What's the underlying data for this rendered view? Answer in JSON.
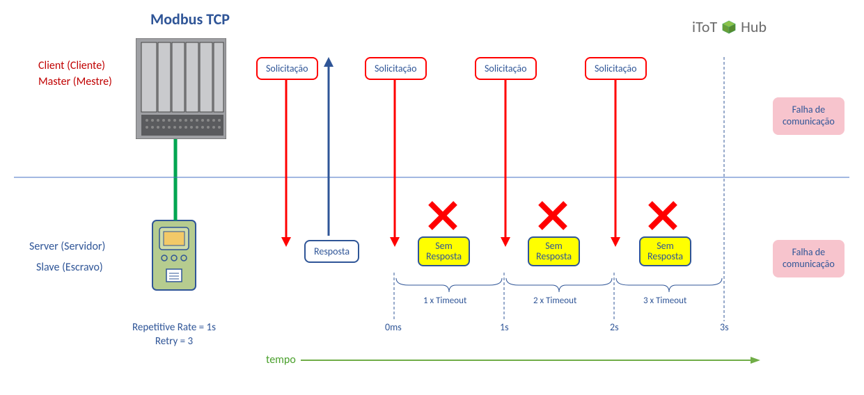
{
  "title": "Modbus TCP",
  "logo_prefix": "iToT",
  "logo_suffix": "Hub",
  "roles": {
    "client": "Client (Cliente)",
    "master": "Master (Mestre)",
    "server": "Server (Servidor)",
    "slave": "Slave (Escravo)"
  },
  "params": {
    "rate": "Repetitive Rate = 1s",
    "retry": "Retry = 3"
  },
  "solicitacao": "Solicitação",
  "resposta": "Resposta",
  "sem_resposta_l1": "Sem",
  "sem_resposta_l2": "Resposta",
  "falha_l1": "Falha de",
  "falha_l2": "comunicação",
  "timeouts": [
    "1 x Timeout",
    "2 x Timeout",
    "3 x Timeout"
  ],
  "ticks": [
    "0ms",
    "1s",
    "2s",
    "3s"
  ],
  "tempo": "tempo",
  "chart_data": {
    "type": "sequence",
    "title": "Modbus TCP communication timeout sequence",
    "actors": [
      "Client/Master (PLC)",
      "Server/Slave (Device)"
    ],
    "parameters": {
      "repetitive_rate_s": 1,
      "retry_count": 3
    },
    "events": [
      {
        "t_s": null,
        "label": "Solicitação",
        "direction": "client_to_server",
        "response": "Resposta"
      },
      {
        "t_s": 0,
        "label": "Solicitação",
        "direction": "client_to_server",
        "response": "Sem Resposta",
        "timeout_index": 1
      },
      {
        "t_s": 1,
        "label": "Solicitação",
        "direction": "client_to_server",
        "response": "Sem Resposta",
        "timeout_index": 2
      },
      {
        "t_s": 2,
        "label": "Solicitação",
        "direction": "client_to_server",
        "response": "Sem Resposta",
        "timeout_index": 3
      },
      {
        "t_s": 3,
        "label": "Falha de comunicação",
        "result": "failure"
      }
    ],
    "tick_labels": [
      "0ms",
      "1s",
      "2s",
      "3s"
    ]
  }
}
